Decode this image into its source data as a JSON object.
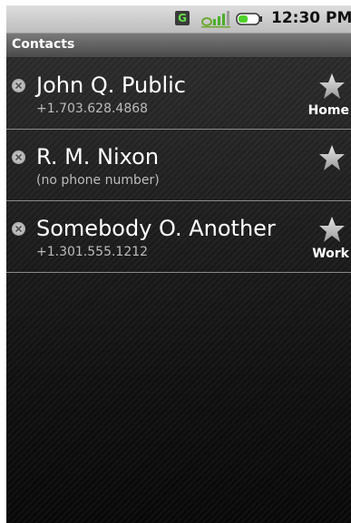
{
  "status_bar": {
    "network_badge": "G",
    "signal_icon": "signal-icon",
    "battery_icon": "battery-icon",
    "time": "12:30 PM"
  },
  "title_bar": {
    "title": "Contacts"
  },
  "contacts": [
    {
      "name": "John Q. Public",
      "phone": "+1.703.628.4868",
      "label": "Home",
      "star_icon": "star-icon",
      "delete_icon": "remove-icon"
    },
    {
      "name": "R. M. Nixon",
      "phone": "(no phone number)",
      "label": "",
      "star_icon": "star-icon",
      "delete_icon": "remove-icon"
    },
    {
      "name": "Somebody O. Another",
      "phone": "+1.301.555.1212",
      "label": "Work",
      "star_icon": "star-icon",
      "delete_icon": "remove-icon"
    }
  ],
  "colors": {
    "background": "#0b0b0b",
    "title_bar": "#5a5a5a",
    "status_bar": "#cfcfcf",
    "battery_fill": "#4fd12c",
    "network_badge_text": "#66e04a"
  }
}
